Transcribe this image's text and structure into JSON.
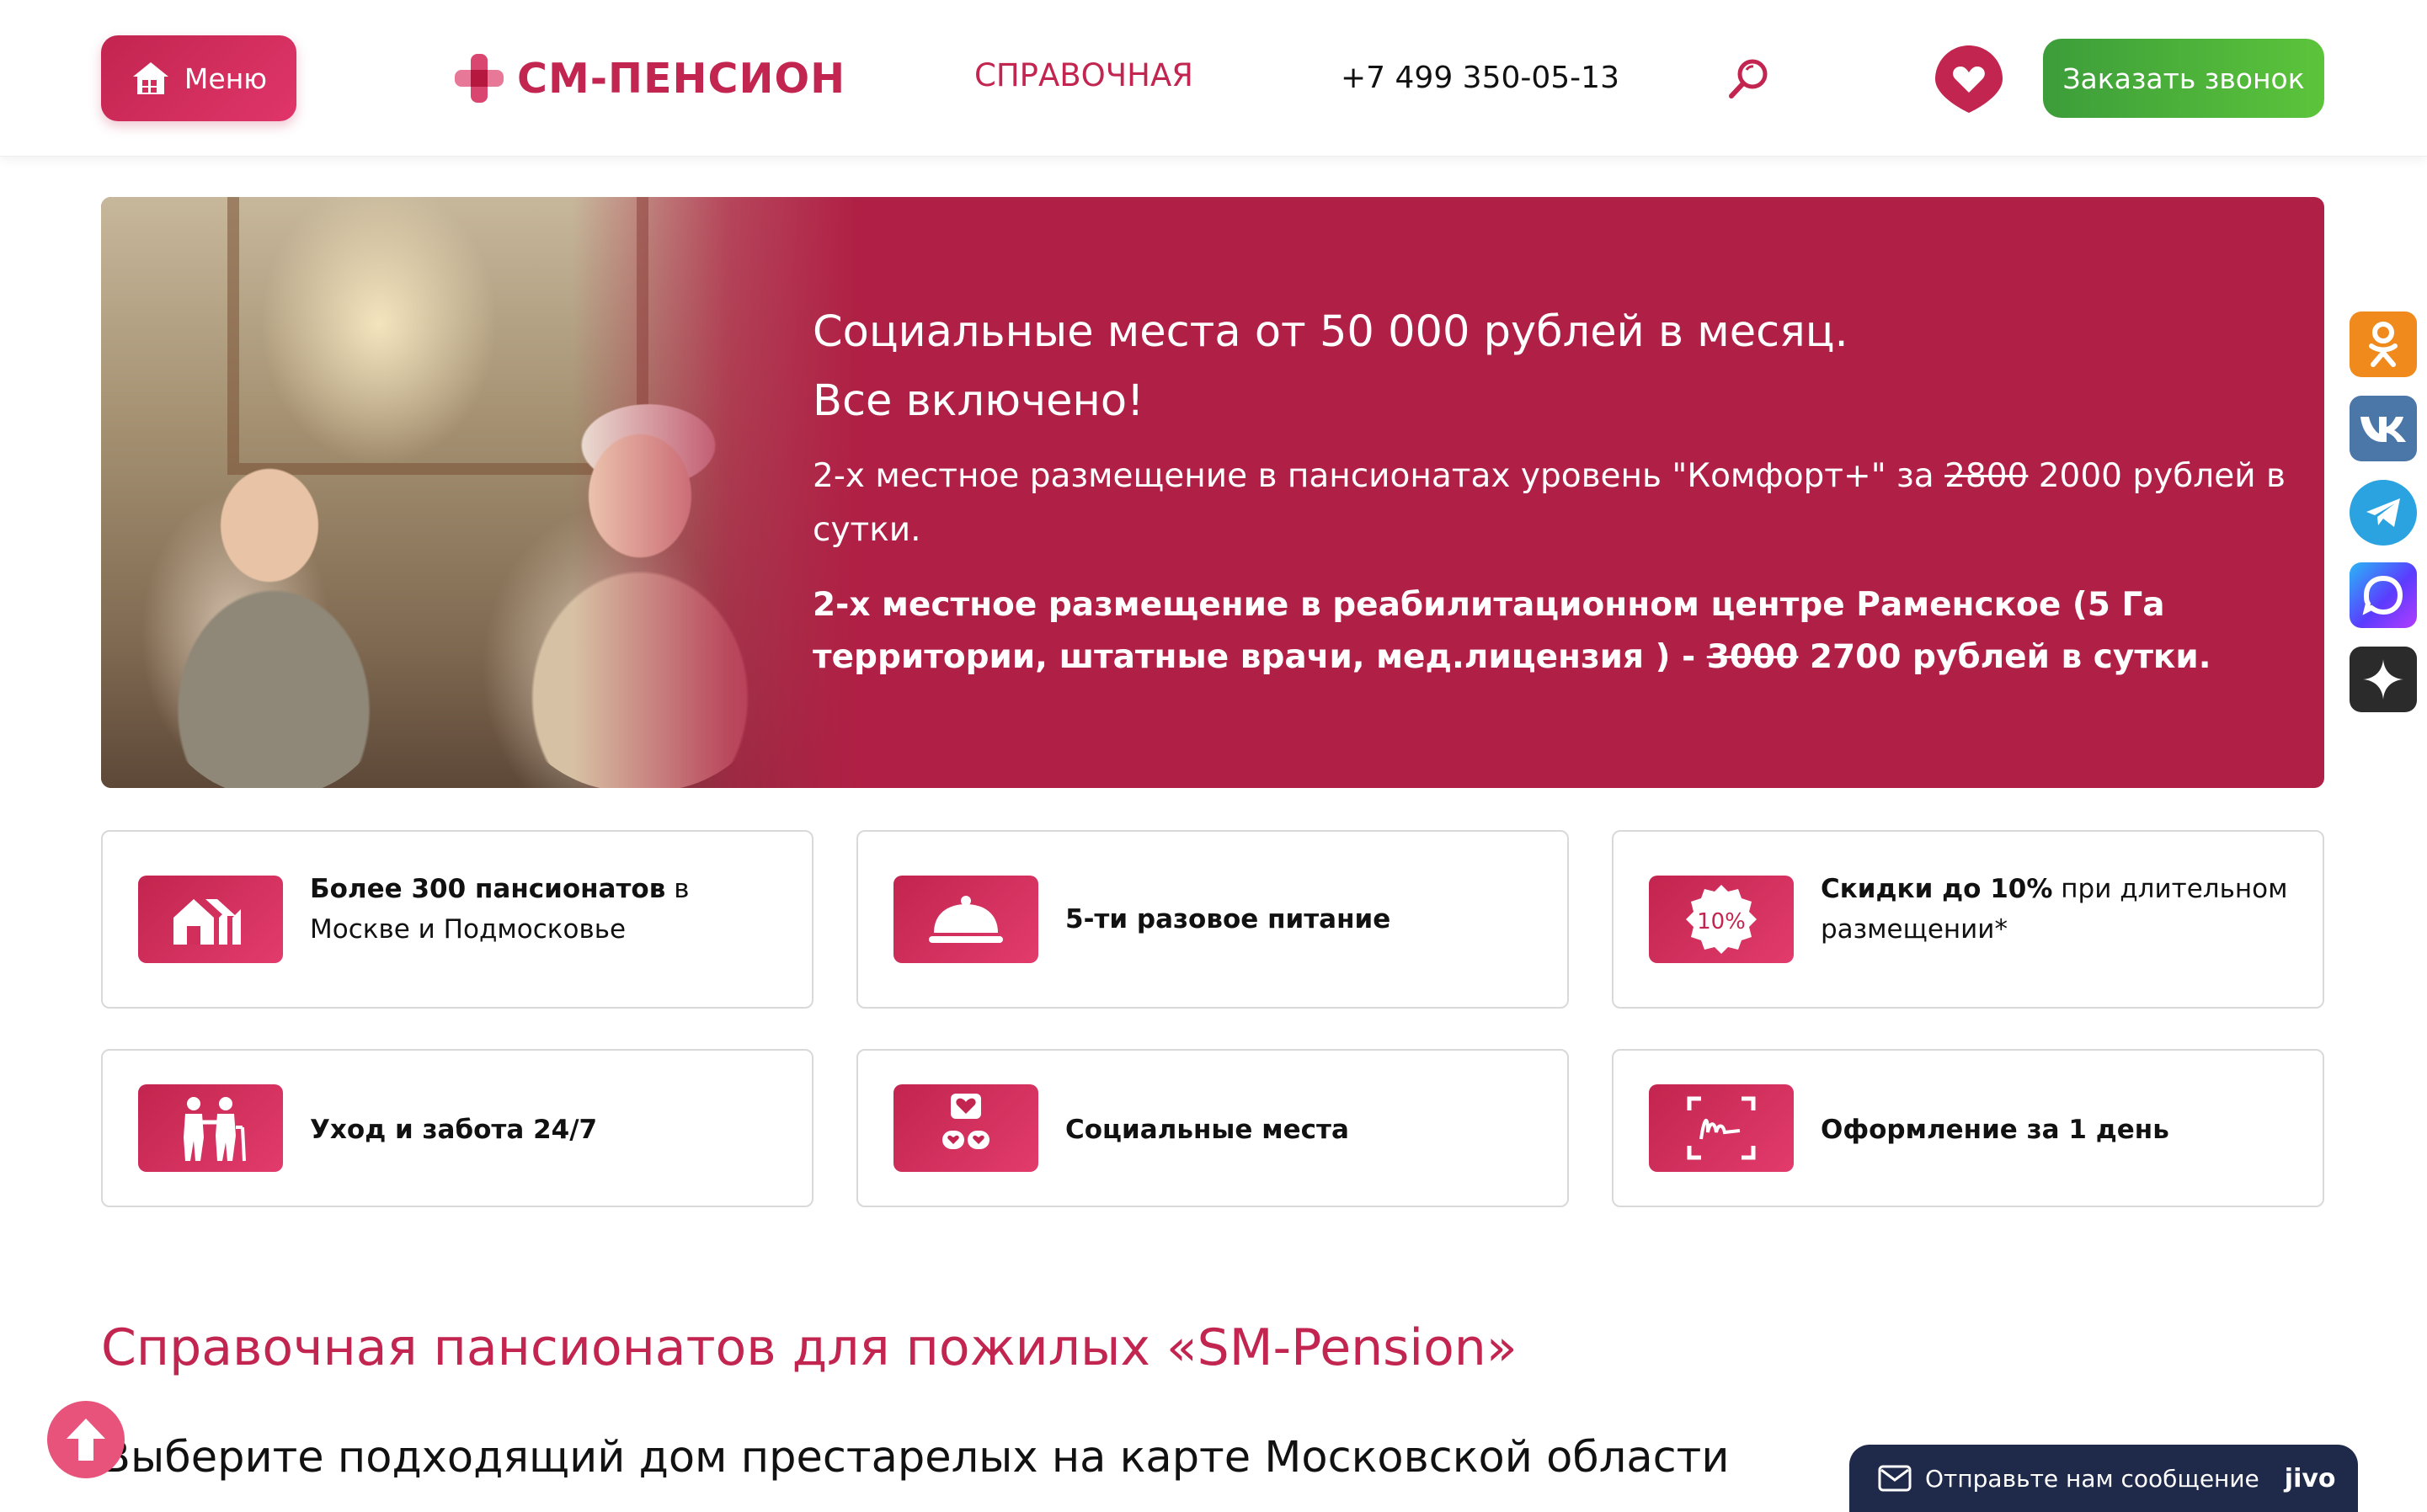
{
  "header": {
    "menu_label": "Меню",
    "logo_text": "СМ-ПЕНСИОН",
    "nav_link": "СПРАВОЧНАЯ",
    "phone": "+7 499 350-05-13",
    "call_button": "Заказать звонок"
  },
  "hero": {
    "title_line1": "Социальные места от 50 000 рублей в месяц.",
    "title_line2": "Все включено!",
    "p1_prefix": "2-х местное размещение в пансионатах уровень \"Комфорт+\" за ",
    "p1_old_price": "2800",
    "p1_suffix": " 2000 рублей в сутки.",
    "p2_prefix": "2-х местное размещение в реабилитационном центре Раменское (5 Га территории, штатные врачи, мед.лицензия ) - ",
    "p2_old_price": "3000",
    "p2_suffix": " 2700 рублей в сутки."
  },
  "features": [
    {
      "bold": "Более 300 пансионатов",
      "rest": " в Москве и Подмосковье",
      "icon": "houses-icon"
    },
    {
      "bold": "5-ти разовое питание",
      "rest": "",
      "icon": "cloche-icon"
    },
    {
      "bold": "Скидки до 10%",
      "rest": " при длительном размещении*",
      "icon": "discount-icon",
      "icon_text": "10%"
    },
    {
      "bold": "Уход и забота 24/7",
      "rest": "",
      "icon": "caregiver-icon"
    },
    {
      "bold": "Социальные места",
      "rest": "",
      "icon": "hearts-icon"
    },
    {
      "bold": "Оформление за 1 день",
      "rest": "",
      "icon": "signature-icon"
    }
  ],
  "section": {
    "title": "Справочная пансионатов для пожилых «SM-Pension»",
    "subtitle": "Выберите подходящий дом престарелых на карте Московской области"
  },
  "social": [
    {
      "name": "odnoklassniki",
      "color": "#f08a1d"
    },
    {
      "name": "vk",
      "color": "#4a76a8"
    },
    {
      "name": "telegram",
      "color": "#2aa3e0"
    },
    {
      "name": "max-messenger",
      "color": "#3a5bff"
    },
    {
      "name": "dzen",
      "color": "#2b2b2b"
    }
  ],
  "chat": {
    "label": "Отправьте нам сообщение",
    "brand": "jivo"
  },
  "colors": {
    "brand": "#c2254f",
    "hero_bg": "#b01f45",
    "cta_green": "#4fb53b",
    "chat_bg": "#1f2a4b"
  }
}
